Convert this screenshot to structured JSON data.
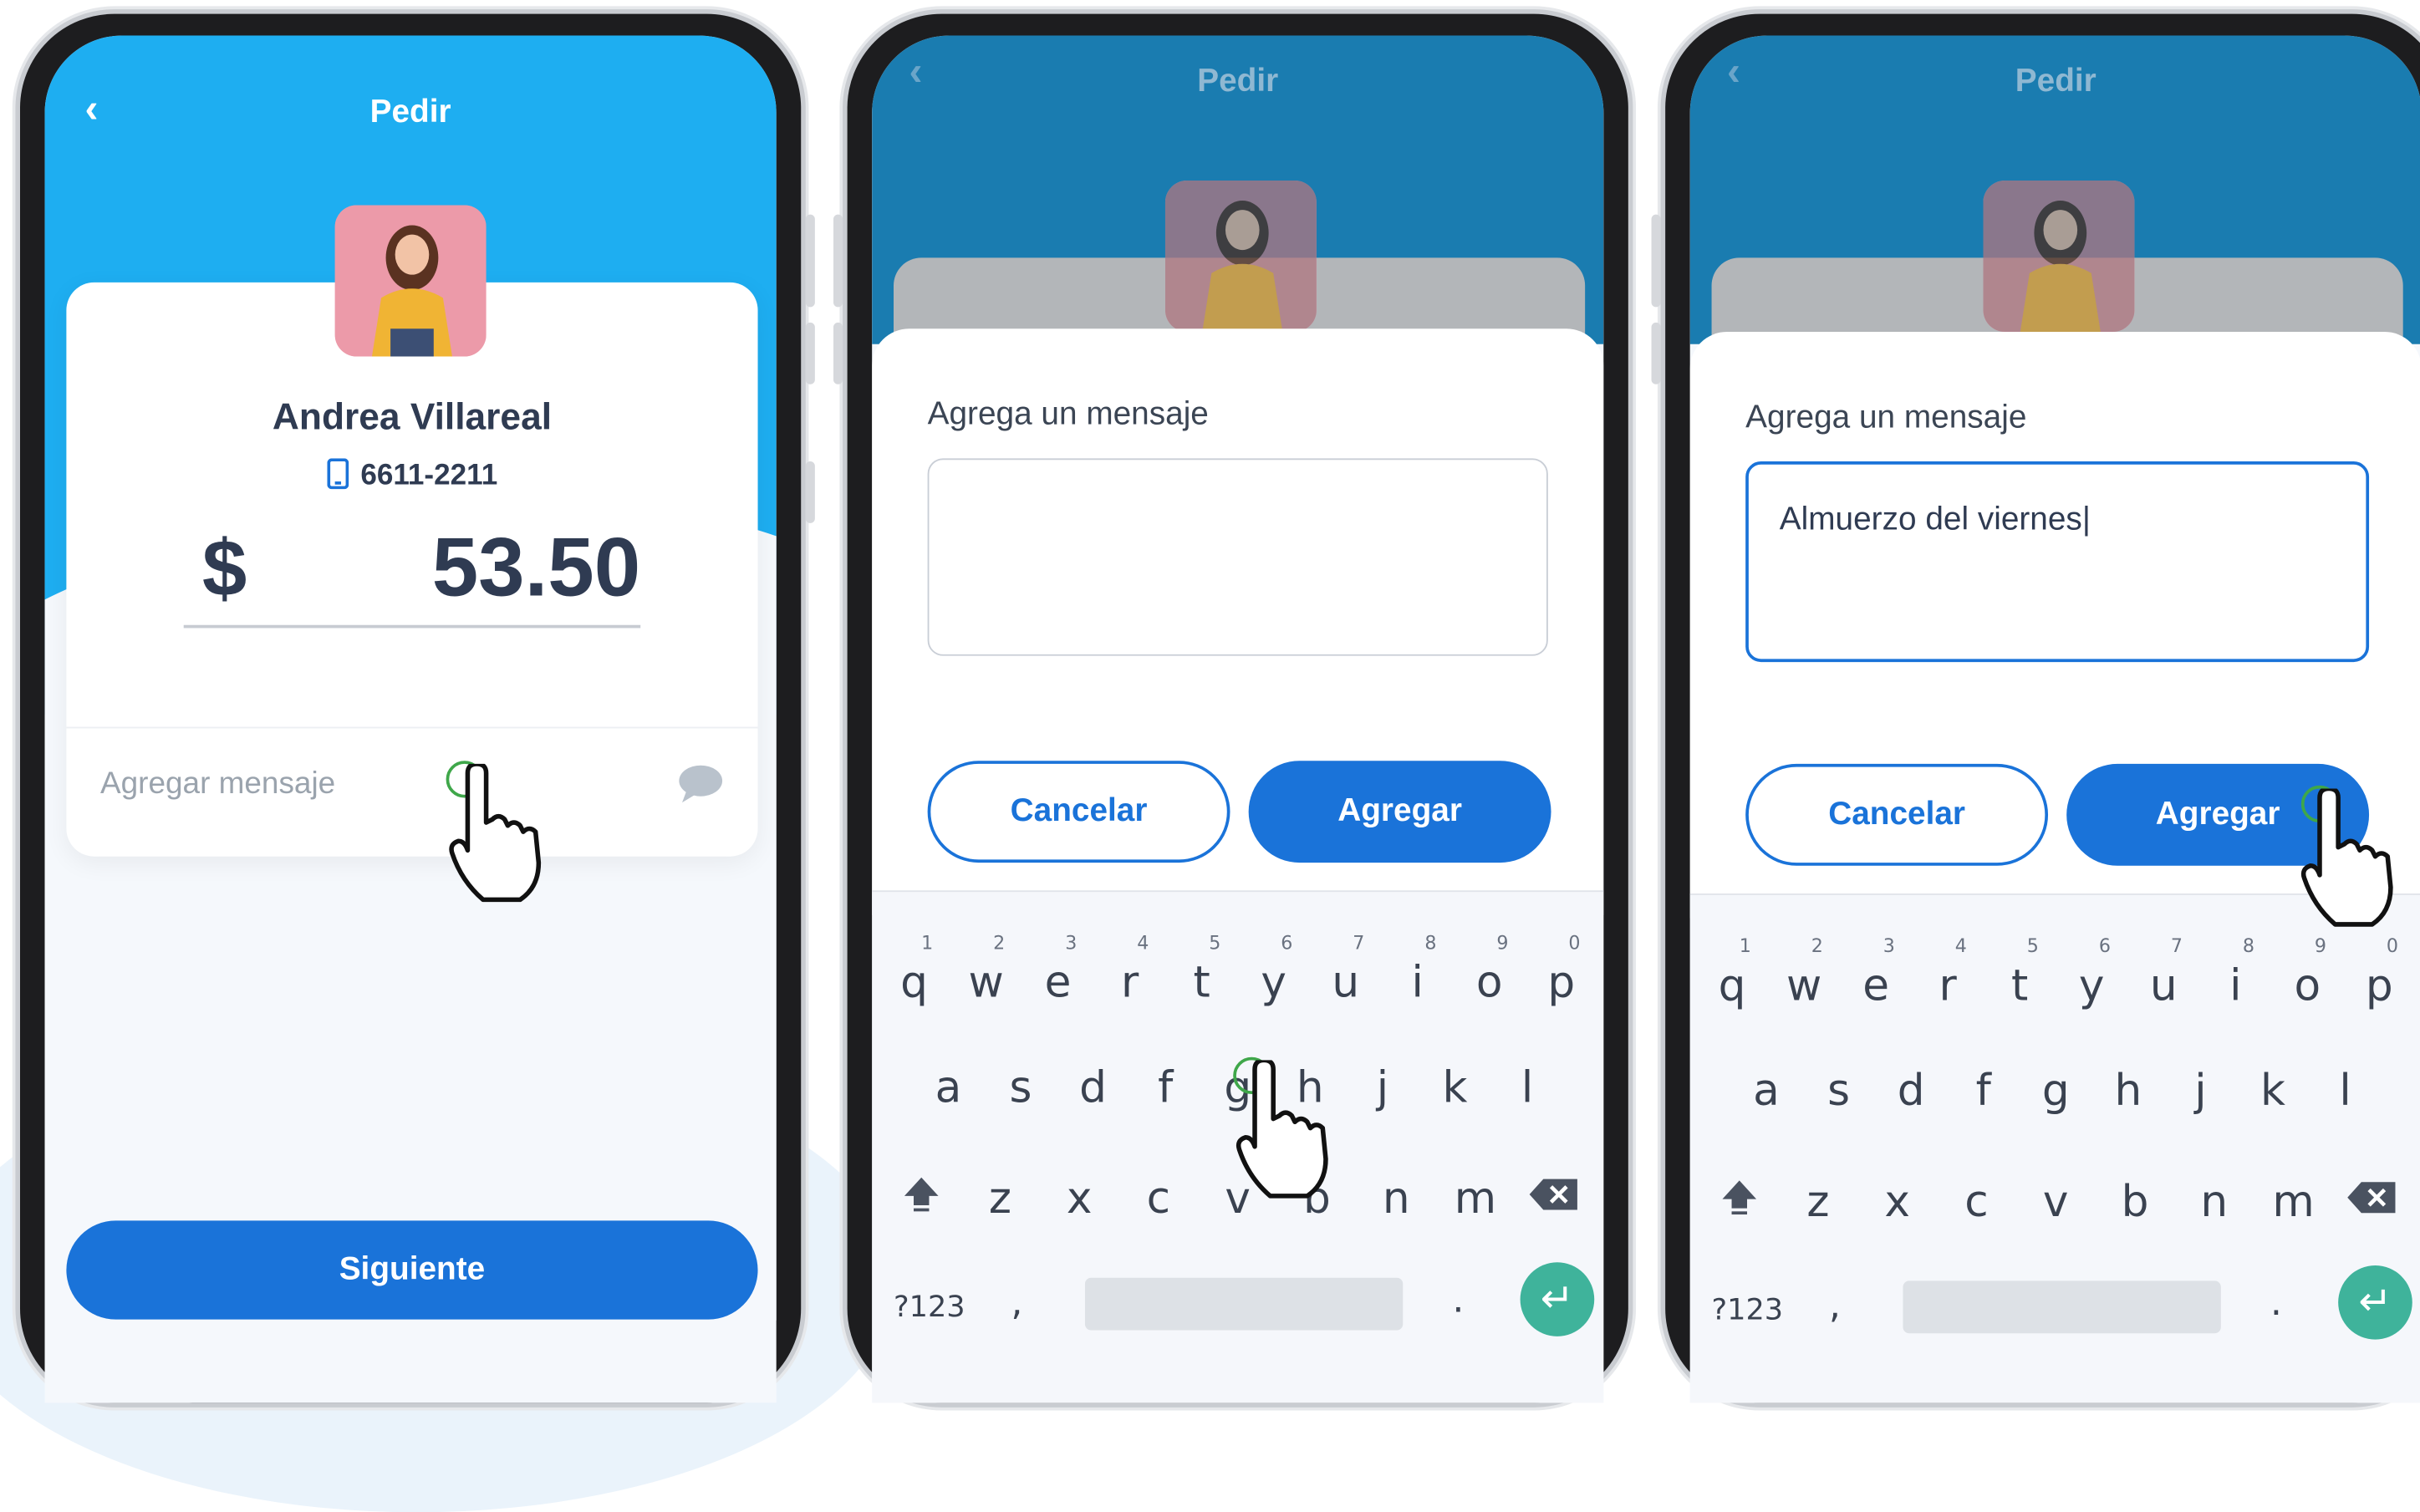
{
  "screens": [
    {
      "title": "Pedir",
      "contact": {
        "name": "Andrea Villareal",
        "phone": "6611-2211"
      },
      "amount": {
        "currency": "$",
        "value": "53.50"
      },
      "message_placeholder": "Agregar mensaje",
      "next_button": "Siguiente"
    },
    {
      "title": "Pedir",
      "dialog": {
        "label": "Agrega un mensaje",
        "text": "",
        "cancel": "Cancelar",
        "confirm": "Agregar"
      }
    },
    {
      "title": "Pedir",
      "dialog": {
        "label": "Agrega un mensaje",
        "text": "Almuerzo del viernes|",
        "cancel": "Cancelar",
        "confirm": "Agregar"
      }
    }
  ],
  "keyboard": {
    "row1": [
      "q",
      "w",
      "e",
      "r",
      "t",
      "y",
      "u",
      "i",
      "o",
      "p"
    ],
    "row1_hints": [
      "1",
      "2",
      "3",
      "4",
      "5",
      "6",
      "7",
      "8",
      "9",
      "0"
    ],
    "row2": [
      "a",
      "s",
      "d",
      "f",
      "g",
      "h",
      "j",
      "k",
      "l"
    ],
    "row3": [
      "z",
      "x",
      "c",
      "v",
      "b",
      "n",
      "m"
    ],
    "symbols": "?123",
    "comma": ",",
    "period": "."
  },
  "colors": {
    "primary": "#1a73d9",
    "header": "#1eaef1",
    "header_dim": "#1a7cb0",
    "enter": "#3fb39b"
  },
  "icons": [
    "back-icon",
    "phone-icon",
    "chat-bubble-icon",
    "shift-icon",
    "backspace-icon",
    "enter-icon",
    "pointer-hand-icon"
  ]
}
